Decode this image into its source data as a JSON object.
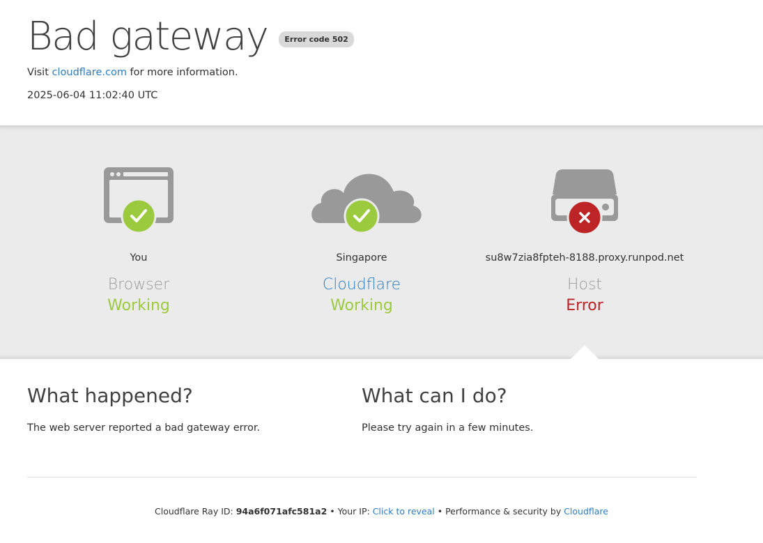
{
  "header": {
    "title": "Bad gateway",
    "error_badge": "Error code 502",
    "visit_prefix": "Visit ",
    "visit_link": "cloudflare.com",
    "visit_suffix": " for more information.",
    "timestamp": "2025-06-04 11:02:40 UTC"
  },
  "nodes": [
    {
      "location": "You",
      "role": "Browser",
      "status": "Working",
      "icon": "browser-icon",
      "badge": "check"
    },
    {
      "location": "Singapore",
      "role": "Cloudflare",
      "status": "Working",
      "icon": "cloud-icon",
      "badge": "check"
    },
    {
      "location": "su8w7zia8fpteh-8188.proxy.runpod.net",
      "role": "Host",
      "status": "Error",
      "icon": "server-icon",
      "badge": "cross"
    }
  ],
  "what_happened": {
    "heading": "What happened?",
    "body": "The web server reported a bad gateway error."
  },
  "what_can_i_do": {
    "heading": "What can I do?",
    "body": "Please try again in a few minutes."
  },
  "footer": {
    "ray_prefix": "Cloudflare Ray ID: ",
    "ray_id": "94a6f071afc581a2",
    "sep1": " • ",
    "ip_prefix": "Your IP: ",
    "ip_link": "Click to reveal",
    "sep2": " • ",
    "perf_prefix": "Performance & security by ",
    "perf_link": "Cloudflare"
  },
  "colors": {
    "link": "#2f7bbf",
    "working": "#9bca3e",
    "error": "#bd2426",
    "icon_gray": "#999999"
  }
}
